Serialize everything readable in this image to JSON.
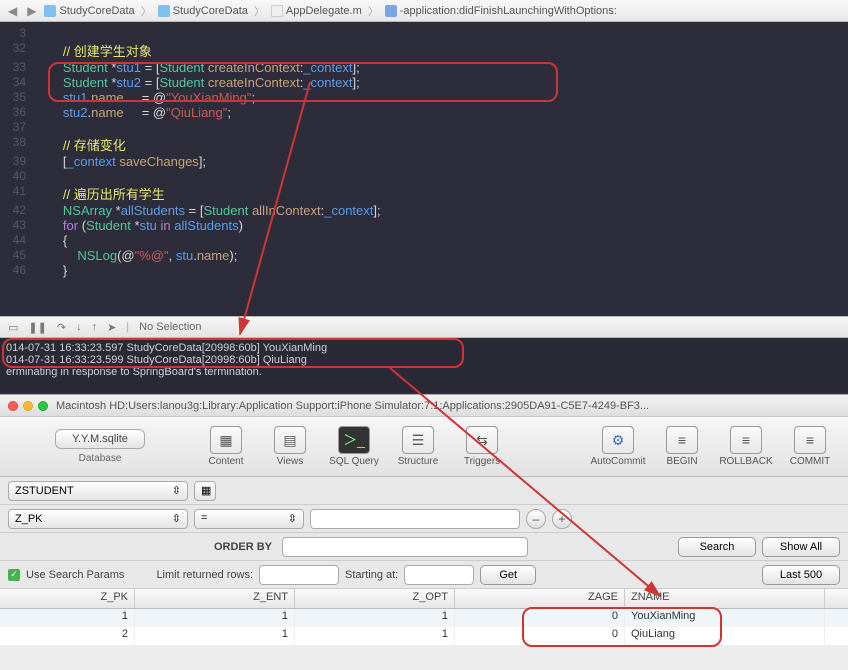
{
  "breadcrumb": {
    "items": [
      "StudyCoreData",
      "StudyCoreData",
      "AppDelegate.m",
      "-application:didFinishLaunchingWithOptions:"
    ]
  },
  "code_lines": [
    {
      "n": "3",
      "html": ""
    },
    {
      "n": "32",
      "html": "<span class='cm-comment'>// 创建学生对象</span>"
    },
    {
      "n": "33",
      "html": "<span class='cm-type'>Student</span> <span class='cm-plain'>*</span><span class='cm-var'>stu1</span> <span class='cm-plain'>= [</span><span class='cm-type'>Student</span> <span class='cm-prop'>createInContext</span><span class='cm-plain'>:</span><span class='cm-var'>_context</span><span class='cm-plain'>];</span>"
    },
    {
      "n": "34",
      "html": "<span class='cm-type'>Student</span> <span class='cm-plain'>*</span><span class='cm-var'>stu2</span> <span class='cm-plain'>= [</span><span class='cm-type'>Student</span> <span class='cm-prop'>createInContext</span><span class='cm-plain'>:</span><span class='cm-var'>_context</span><span class='cm-plain'>];</span>"
    },
    {
      "n": "35",
      "html": "<span class='cm-var'>stu1</span><span class='cm-plain'>.</span><span class='cm-prop'>name</span>     <span class='cm-plain'>= @</span><span class='cm-str'>\"YouXianMing\"</span><span class='cm-plain'>;</span>"
    },
    {
      "n": "36",
      "html": "<span class='cm-var'>stu2</span><span class='cm-plain'>.</span><span class='cm-prop'>name</span>     <span class='cm-plain'>= @</span><span class='cm-str'>\"QiuLiang\"</span><span class='cm-plain'>;</span>"
    },
    {
      "n": "37",
      "html": ""
    },
    {
      "n": "38",
      "html": "<span class='cm-comment'>// 存储变化</span>"
    },
    {
      "n": "39",
      "html": "<span class='cm-plain'>[</span><span class='cm-var'>_context</span> <span class='cm-prop'>saveChanges</span><span class='cm-plain'>];</span>"
    },
    {
      "n": "40",
      "html": ""
    },
    {
      "n": "41",
      "html": "<span class='cm-comment'>// 遍历出所有学生</span>"
    },
    {
      "n": "42",
      "html": "<span class='cm-type'>NSArray</span> <span class='cm-plain'>*</span><span class='cm-var'>allStudents</span> <span class='cm-plain'>= [</span><span class='cm-type'>Student</span> <span class='cm-prop'>allInContext</span><span class='cm-plain'>:</span><span class='cm-var'>_context</span><span class='cm-plain'>];</span>"
    },
    {
      "n": "43",
      "html": "<span class='cm-kw'>for</span> <span class='cm-plain'>(</span><span class='cm-type'>Student</span> <span class='cm-plain'>*</span><span class='cm-var'>stu</span> <span class='cm-kw'>in</span> <span class='cm-var'>allStudents</span><span class='cm-plain'>)</span>"
    },
    {
      "n": "44",
      "html": "<span class='cm-plain'>{</span>"
    },
    {
      "n": "45",
      "html": "    <span class='cm-type'>NSLog</span><span class='cm-plain'>(@</span><span class='cm-str'>\"%@\"</span><span class='cm-plain'>, </span><span class='cm-var'>stu</span><span class='cm-plain'>.</span><span class='cm-prop'>name</span><span class='cm-plain'>);</span>"
    },
    {
      "n": "46",
      "html": "<span class='cm-plain'>}</span>"
    }
  ],
  "consolebar": {
    "noselection": "No Selection"
  },
  "console": [
    "014-07-31 16:33:23.597 StudyCoreData[20998:60b] YouXianMing",
    "014-07-31 16:33:23.599 StudyCoreData[20998:60b] QiuLiang",
    "erminating in response to SpringBoard's termination."
  ],
  "db": {
    "title": "Macintosh HD:Users:lanou3g:Library:Application Support:iPhone Simulator:7.1:Applications:2905DA91-C5E7-4249-BF3...",
    "file_button": "Y.Y.M.sqlite",
    "file_label": "Database",
    "tools": [
      "Content",
      "Views",
      "SQL Query",
      "Structure",
      "Triggers"
    ],
    "right_tools": [
      "AutoCommit",
      "BEGIN",
      "ROLLBACK",
      "COMMIT"
    ],
    "table_select": "ZSTUDENT",
    "pk_select": "Z_PK",
    "op_select": "=",
    "order_label": "ORDER BY",
    "search": "Search",
    "showall": "Show All",
    "use_search": "Use Search Params",
    "limit_label": "Limit returned rows:",
    "starting_label": "Starting at:",
    "get": "Get",
    "last500": "Last 500",
    "columns": [
      "Z_PK",
      "Z_ENT",
      "Z_OPT",
      "ZAGE",
      "ZNAME"
    ],
    "rows": [
      {
        "pk": "1",
        "ent": "1",
        "opt": "1",
        "age": "0",
        "name": "YouXianMing"
      },
      {
        "pk": "2",
        "ent": "1",
        "opt": "1",
        "age": "0",
        "name": "QiuLiang"
      }
    ]
  }
}
